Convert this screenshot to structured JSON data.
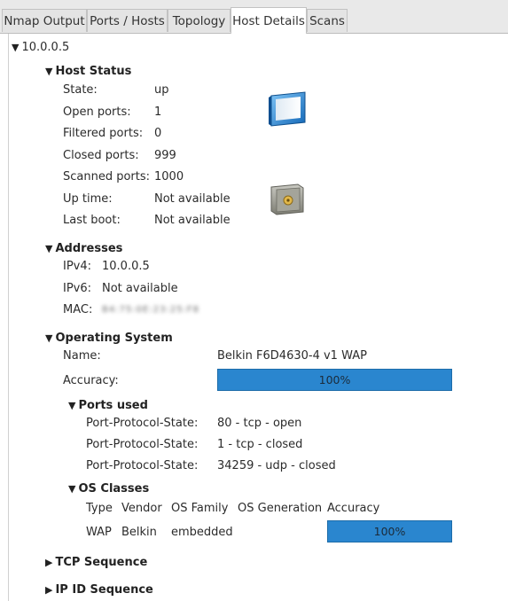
{
  "tabs": [
    {
      "label": "Nmap Output"
    },
    {
      "label": "Ports / Hosts"
    },
    {
      "label": "Topology"
    },
    {
      "label": "Host Details",
      "active": true
    },
    {
      "label": "Scans"
    }
  ],
  "host": {
    "ip": "10.0.0.5",
    "status": {
      "heading": "Host Status",
      "state_label": "State:",
      "state": "up",
      "open_label": "Open ports:",
      "open": "1",
      "filtered_label": "Filtered ports:",
      "filtered": "0",
      "closed_label": "Closed ports:",
      "closed": "999",
      "scanned_label": "Scanned ports:",
      "scanned": "1000",
      "uptime_label": "Up time:",
      "uptime": "Not available",
      "lastboot_label": "Last boot:",
      "lastboot": "Not available",
      "os_icon": "monitor-icon",
      "vuln_icon": "safe-icon"
    },
    "addresses": {
      "heading": "Addresses",
      "ipv4_label": "IPv4:",
      "ipv4": "10.0.0.5",
      "ipv6_label": "IPv6:",
      "ipv6": "Not available",
      "mac_label": "MAC:",
      "mac": "B4:75:0E:23:25:F8"
    },
    "os": {
      "heading": "Operating System",
      "name_label": "Name:",
      "name": "Belkin F6D4630-4 v1 WAP",
      "accuracy_label": "Accuracy:",
      "accuracy": "100%",
      "accuracy_fraction": 1.0,
      "ports_used": {
        "heading": "Ports used",
        "label": "Port-Protocol-State:",
        "rows": [
          "80 - tcp - open",
          "1 - tcp - closed",
          "34259 - udp - closed"
        ]
      },
      "os_classes": {
        "heading": "OS Classes",
        "columns": [
          "Type",
          "Vendor",
          "OS Family",
          "OS Generation",
          "Accuracy"
        ],
        "row": {
          "type": "WAP",
          "vendor": "Belkin",
          "family": "embedded",
          "generation": "",
          "accuracy": "100%",
          "accuracy_fraction": 1.0
        }
      }
    },
    "tcp_sequence": "TCP Sequence",
    "ipid_sequence": "IP ID Sequence"
  },
  "colors": {
    "progress": "#2a86cf",
    "tab_bg": "#e9e9e9"
  }
}
